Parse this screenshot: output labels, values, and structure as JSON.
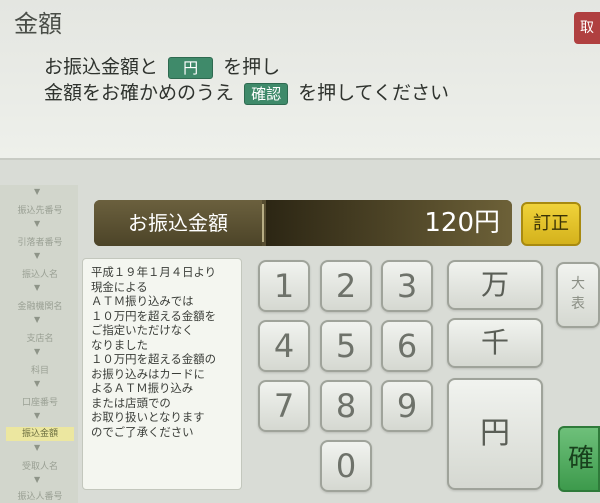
{
  "header": {
    "title": "金額",
    "corner_label": "取"
  },
  "instructions": {
    "line1_pre": "お振込金額と",
    "line1_chip": "円",
    "line1_post": "を押し",
    "line2_pre": "金額をお確かめのうえ",
    "line2_chip": "確認",
    "line2_post": "を押してください"
  },
  "sidebar": {
    "items": [
      "振込先番号",
      "引落者番号",
      "振込人名",
      "金融機関名",
      "支店名",
      "科目",
      "口座番号",
      "振込金額",
      "受取人名",
      "振込人番号"
    ]
  },
  "amount": {
    "label": "お振込金額",
    "value": "120円"
  },
  "buttons": {
    "correct": "訂正",
    "confirm": "確",
    "man": "万",
    "sen": "千",
    "yen": "円",
    "partial_top": "大",
    "partial_bottom": "表"
  },
  "keypad": [
    "1",
    "2",
    "3",
    "4",
    "5",
    "6",
    "7",
    "8",
    "9",
    "0"
  ],
  "notice": {
    "lines": [
      "平成１９年１月４日より",
      "現金による",
      "ＡＴＭ振り込みでは",
      "１０万円を超える金額を",
      "ご指定いただけなく",
      "なりました",
      "１０万円を超える金額の",
      "お振り込みはカードに",
      "よるＡＴＭ振り込み",
      "または店頭での",
      "お取り扱いとなります",
      "のでご了承ください"
    ]
  }
}
